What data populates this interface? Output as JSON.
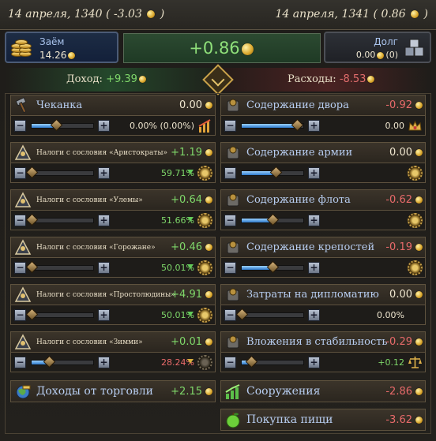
{
  "dates": {
    "left_date": "14 апреля, 1340 ( -3.03",
    "left_close": ")",
    "right_date": "14 апреля, 1341 ( 0.86",
    "right_close": ")"
  },
  "summary": {
    "loan_title": "Заём",
    "loan_value": "14.26",
    "balance": "+0.86",
    "debt_title": "Долг",
    "debt_value": "0.00",
    "debt_count": "(0)"
  },
  "income_expense": {
    "income_label": "Доход:",
    "income_value": "+9.39",
    "expense_label": "Расходы:",
    "expense_value": "-8.53"
  },
  "left": {
    "minting": {
      "label": "Чеканка",
      "value": "0.00",
      "control_text": "0.00% (0.00%)",
      "slider_level": 0.4,
      "icon": "hammer-icon"
    },
    "estates": [
      {
        "label": "Налоги с сословия «Аристократы»",
        "value": "+1.19",
        "percent": "59.71%",
        "slider_level": 0.0,
        "icon": "aristocrats-icon"
      },
      {
        "label": "Налоги с сословия «Улемы»",
        "value": "+0.64",
        "percent": "51.66%",
        "slider_level": 0.0,
        "icon": "ulema-icon"
      },
      {
        "label": "Налоги с сословия «Горожане»",
        "value": "+0.46",
        "percent": "50.01%",
        "slider_level": 0.0,
        "icon": "burghers-icon"
      },
      {
        "label": "Налоги с сословия «Простолюдины»",
        "value": "+4.91",
        "percent": "50.01%",
        "slider_level": 0.0,
        "icon": "commoners-icon"
      },
      {
        "label": "Налоги с сословия «Зимми»",
        "value": "+0.01",
        "percent": "28.24%",
        "slider_level": 0.28,
        "icon": "dhimmi-icon"
      }
    ],
    "trade": {
      "label": "Доходы от торговли",
      "value": "+2.15",
      "icon": "trade-icon"
    }
  },
  "right": {
    "rows": [
      {
        "label": "Содержание двора",
        "value": "-0.92",
        "control_text": "0.00",
        "slider_level": 0.9,
        "icon": "court-icon",
        "ctrl_icon": "crown-icon"
      },
      {
        "label": "Содержание армии",
        "value": "0.00",
        "control_text": "",
        "slider_level": 0.55,
        "icon": "army-icon",
        "ctrl_icon": "gear-icon"
      },
      {
        "label": "Содержание флота",
        "value": "-0.62",
        "control_text": "",
        "slider_level": 0.5,
        "icon": "navy-icon",
        "ctrl_icon": "gear-icon"
      },
      {
        "label": "Содержание крепостей",
        "value": "-0.19",
        "control_text": "",
        "slider_level": 0.5,
        "icon": "fort-icon",
        "ctrl_icon": "gear-icon"
      },
      {
        "label": "Затраты на дипломатию",
        "value": "0.00",
        "control_text": "0.00%",
        "slider_level": 0.0,
        "icon": "dove-icon",
        "ctrl_icon": ""
      },
      {
        "label": "Вложения в стабильность",
        "value": "-0.29",
        "control_text": "+0.12",
        "slider_level": 0.15,
        "icon": "scales-icon",
        "ctrl_icon": "scales-icon"
      }
    ],
    "buildings": {
      "label": "Сооружения",
      "value": "-2.86",
      "icon": "chart-icon"
    },
    "food": {
      "label": "Покупка пищи",
      "value": "-3.62",
      "icon": "apple-icon"
    }
  },
  "colors": {
    "positive": "#7fd86a",
    "negative": "#e86a6a",
    "label": "#b7cdf0",
    "gold": "#d9a52a"
  }
}
